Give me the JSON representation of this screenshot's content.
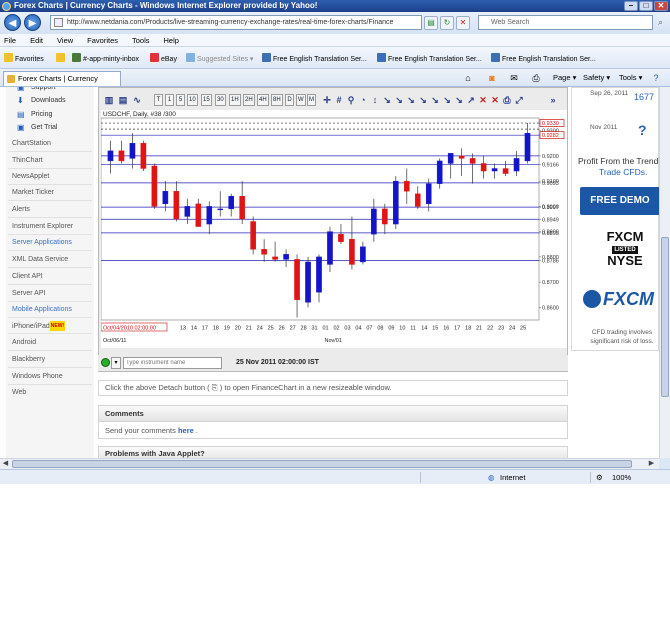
{
  "window": {
    "title": "Forex Charts | Currency Charts - Windows Internet Explorer provided by Yahoo!"
  },
  "address_bar": {
    "url": "http://www.netdania.com/Products/live-streaming-currency-exchange-rates/real-time-forex-charts/Finance",
    "search_placeholder": "Web Search"
  },
  "menu": [
    "File",
    "Edit",
    "View",
    "Favorites",
    "Tools",
    "Help"
  ],
  "favorites_bar": {
    "favorites_label": "Favorites",
    "items": [
      "#-app-minty-inbox",
      "eBay",
      "Suggested Sites ▾",
      "Free English Translation Ser...",
      "Free English Translation Ser...",
      "Free English Translation Ser..."
    ]
  },
  "tab": {
    "title": "Forex Charts | Currency Charts"
  },
  "command_bar": {
    "page": "Page ▾",
    "safety": "Safety ▾",
    "tools": "Tools ▾"
  },
  "sidebar": {
    "items": [
      {
        "label": "Support",
        "type": "sub"
      },
      {
        "label": "Downloads",
        "type": "sub"
      },
      {
        "label": "Pricing",
        "type": "sub"
      },
      {
        "label": "Get Trial",
        "type": "sub"
      },
      {
        "label": "ChartStation",
        "type": "item"
      },
      {
        "label": "ThinChart",
        "type": "item"
      },
      {
        "label": "NewsApplet",
        "type": "item"
      },
      {
        "label": "Market Ticker",
        "type": "item"
      },
      {
        "label": "Alerts",
        "type": "item"
      },
      {
        "label": "Instrument Explorer",
        "type": "item"
      },
      {
        "label": "Server Applications",
        "type": "head"
      },
      {
        "label": "XML Data Service",
        "type": "item"
      },
      {
        "label": "Client API",
        "type": "item"
      },
      {
        "label": "Server API",
        "type": "item"
      },
      {
        "label": "Mobile Applications",
        "type": "head"
      },
      {
        "label": "iPhone/iPad",
        "type": "item",
        "badge": "NEW!"
      },
      {
        "label": "Android",
        "type": "item"
      },
      {
        "label": "Blackberry",
        "type": "item"
      },
      {
        "label": "Windows Phone",
        "type": "item"
      },
      {
        "label": "Web",
        "type": "item"
      }
    ]
  },
  "chart_toolbar": {
    "periods": [
      "T",
      "1",
      "5",
      "10",
      "15",
      "30",
      "1H",
      "2H",
      "4H",
      "8H",
      "D",
      "W",
      "M"
    ]
  },
  "chart_data": {
    "type": "candlestick",
    "title": "USDCHF, Daily, #38 /300",
    "y_axis_side": "right",
    "ylim": [
      0.855,
      0.935
    ],
    "y_ticks": [
      0.86,
      0.87,
      0.8786,
      0.88,
      0.8895,
      0.89,
      0.8949,
      0.8997,
      0.9,
      0.9093,
      0.91,
      0.9166,
      0.92,
      0.9282,
      0.93,
      0.933
    ],
    "y_tick_labels": [
      "0.8600",
      "0.8700",
      "0.8786",
      "0.8800",
      "0.8895",
      "0.8900",
      "0.8949",
      "0.8997",
      "0.9000",
      "0.9093",
      "0.9100",
      "0.9166",
      "0.9200",
      "0.9282",
      "0.9300",
      "0.9330"
    ],
    "y_ticks_truncated": [
      "0.9306",
      "0.9330",
      "0.9326",
      "0.9290"
    ],
    "horizontal_lines": [
      0.8786,
      0.8895,
      0.8949,
      0.8997,
      0.9093,
      0.9166,
      0.92,
      0.9282,
      0.9306,
      0.933
    ],
    "price_tags": [
      "0.9330",
      "0.9282"
    ],
    "x_tick_labels": [
      "Oct/04/2010 02:00:00",
      "13",
      "14",
      "17",
      "18",
      "19",
      "20",
      "21",
      "24",
      "25",
      "26",
      "27",
      "28",
      "31",
      "01",
      "02",
      "03",
      "04",
      "07",
      "08",
      "09",
      "10",
      "11",
      "14",
      "15",
      "16",
      "17",
      "18",
      "21",
      "22",
      "23",
      "24",
      "25"
    ],
    "x_bottom_labels": [
      "Oct/06/11",
      "Nov/01"
    ],
    "up_color": "#1414c8",
    "down_color": "#e01414",
    "candles": [
      {
        "o": 0.918,
        "h": 0.926,
        "l": 0.913,
        "c": 0.922
      },
      {
        "o": 0.922,
        "h": 0.926,
        "l": 0.917,
        "c": 0.918
      },
      {
        "o": 0.919,
        "h": 0.929,
        "l": 0.915,
        "c": 0.925
      },
      {
        "o": 0.925,
        "h": 0.926,
        "l": 0.914,
        "c": 0.915
      },
      {
        "o": 0.916,
        "h": 0.917,
        "l": 0.899,
        "c": 0.9
      },
      {
        "o": 0.901,
        "h": 0.91,
        "l": 0.898,
        "c": 0.906
      },
      {
        "o": 0.906,
        "h": 0.91,
        "l": 0.894,
        "c": 0.895
      },
      {
        "o": 0.896,
        "h": 0.903,
        "l": 0.893,
        "c": 0.9
      },
      {
        "o": 0.901,
        "h": 0.903,
        "l": 0.892,
        "c": 0.892
      },
      {
        "o": 0.893,
        "h": 0.902,
        "l": 0.889,
        "c": 0.9
      },
      {
        "o": 0.899,
        "h": 0.906,
        "l": 0.896,
        "c": 0.899
      },
      {
        "o": 0.899,
        "h": 0.905,
        "l": 0.896,
        "c": 0.904
      },
      {
        "o": 0.904,
        "h": 0.91,
        "l": 0.893,
        "c": 0.895
      },
      {
        "o": 0.894,
        "h": 0.896,
        "l": 0.881,
        "c": 0.883
      },
      {
        "o": 0.883,
        "h": 0.887,
        "l": 0.878,
        "c": 0.881
      },
      {
        "o": 0.88,
        "h": 0.886,
        "l": 0.878,
        "c": 0.879
      },
      {
        "o": 0.879,
        "h": 0.883,
        "l": 0.876,
        "c": 0.881
      },
      {
        "o": 0.879,
        "h": 0.881,
        "l": 0.856,
        "c": 0.863
      },
      {
        "o": 0.862,
        "h": 0.88,
        "l": 0.86,
        "c": 0.878
      },
      {
        "o": 0.866,
        "h": 0.881,
        "l": 0.862,
        "c": 0.88
      },
      {
        "o": 0.877,
        "h": 0.892,
        "l": 0.874,
        "c": 0.89
      },
      {
        "o": 0.889,
        "h": 0.893,
        "l": 0.885,
        "c": 0.886
      },
      {
        "o": 0.887,
        "h": 0.896,
        "l": 0.875,
        "c": 0.877
      },
      {
        "o": 0.878,
        "h": 0.886,
        "l": 0.877,
        "c": 0.884
      },
      {
        "o": 0.889,
        "h": 0.903,
        "l": 0.886,
        "c": 0.899
      },
      {
        "o": 0.899,
        "h": 0.901,
        "l": 0.889,
        "c": 0.893
      },
      {
        "o": 0.893,
        "h": 0.912,
        "l": 0.891,
        "c": 0.91
      },
      {
        "o": 0.91,
        "h": 0.915,
        "l": 0.901,
        "c": 0.906
      },
      {
        "o": 0.905,
        "h": 0.908,
        "l": 0.899,
        "c": 0.9
      },
      {
        "o": 0.901,
        "h": 0.911,
        "l": 0.898,
        "c": 0.909
      },
      {
        "o": 0.909,
        "h": 0.919,
        "l": 0.907,
        "c": 0.918
      },
      {
        "o": 0.917,
        "h": 0.921,
        "l": 0.911,
        "c": 0.921
      },
      {
        "o": 0.92,
        "h": 0.923,
        "l": 0.912,
        "c": 0.919
      },
      {
        "o": 0.919,
        "h": 0.921,
        "l": 0.909,
        "c": 0.917
      },
      {
        "o": 0.917,
        "h": 0.92,
        "l": 0.911,
        "c": 0.914
      },
      {
        "o": 0.914,
        "h": 0.917,
        "l": 0.911,
        "c": 0.915
      },
      {
        "o": 0.915,
        "h": 0.918,
        "l": 0.912,
        "c": 0.913
      },
      {
        "o": 0.914,
        "h": 0.922,
        "l": 0.912,
        "c": 0.919
      },
      {
        "o": 0.918,
        "h": 0.933,
        "l": 0.917,
        "c": 0.929
      }
    ]
  },
  "chart_footer": {
    "instrument_placeholder": "Type instrument name",
    "datetime": "25 Nov 2011 02:00:00 IST"
  },
  "detach_text": "Click the above Detach button ( ⎘ ) to open FinanceChart in a new resizeable window.",
  "comments": {
    "heading": "Comments",
    "prefix": "Send your comments ",
    "link": "here",
    "suffix": " ."
  },
  "problems_heading": "Problems with Java Applet?",
  "right_panel": {
    "news": [
      {
        "date": "Sep 26,\n2011",
        "value": "1677"
      },
      {
        "date": "Nov\n2011",
        "value": "?"
      }
    ],
    "ad_line1": "Profit From the Trend",
    "ad_line2": "Trade CFDs.",
    "demo_button": "FREE DEMO",
    "fxcm_top": "FXCM",
    "fxcm_listed": "LISTED",
    "fxcm_nyse": "NYSE",
    "fxcm_logo": "FXCM",
    "risk": "CFD trading involves significant risk of loss."
  },
  "status_bar": {
    "zone": "Internet",
    "zoom": "100%"
  }
}
